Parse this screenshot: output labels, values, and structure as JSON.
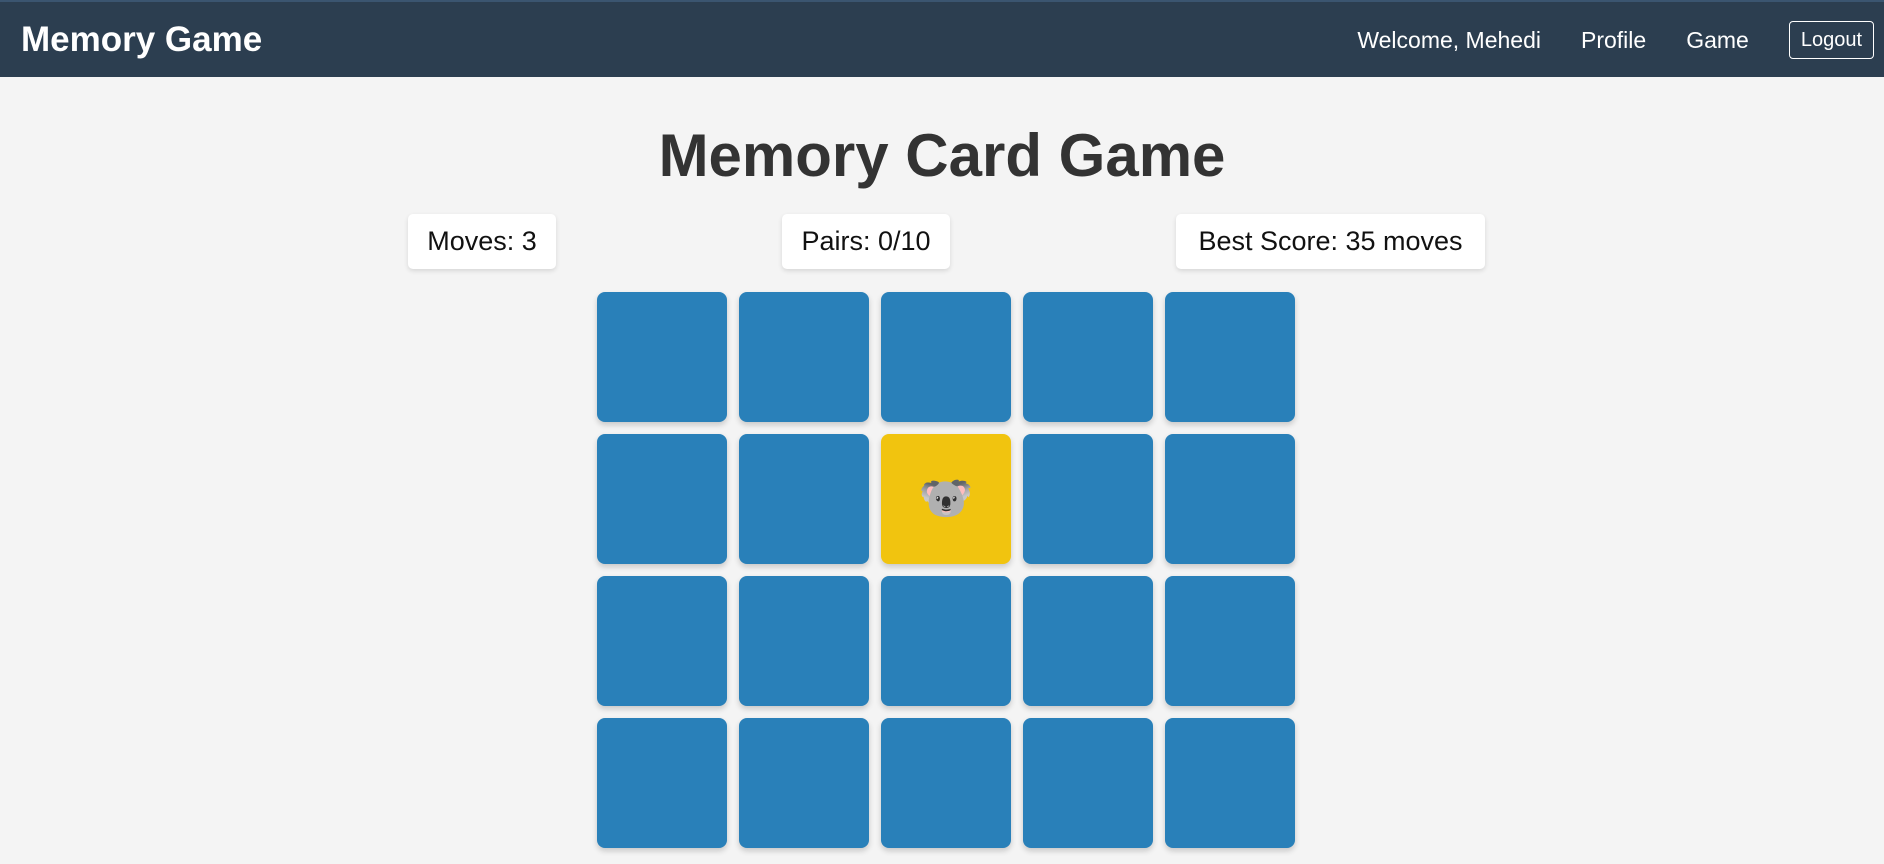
{
  "nav": {
    "brand": "Memory Game",
    "welcome": "Welcome, Mehedi",
    "links": [
      "Profile",
      "Game"
    ],
    "logout": "Logout"
  },
  "title": "Memory Card Game",
  "stats": {
    "moves": "Moves: 3",
    "pairs": "Pairs: 0/10",
    "best": "Best Score: 35 moves"
  },
  "colors": {
    "card_back": "#2980b9",
    "card_flipped": "#f1c40f",
    "navbar": "#2c3e50"
  },
  "board": {
    "columns": 5,
    "cards": [
      {
        "state": "hidden",
        "face": ""
      },
      {
        "state": "hidden",
        "face": ""
      },
      {
        "state": "hidden",
        "face": ""
      },
      {
        "state": "hidden",
        "face": ""
      },
      {
        "state": "hidden",
        "face": ""
      },
      {
        "state": "hidden",
        "face": ""
      },
      {
        "state": "hidden",
        "face": ""
      },
      {
        "state": "flipped",
        "face": "🐨",
        "icon": "koala-icon"
      },
      {
        "state": "hidden",
        "face": ""
      },
      {
        "state": "hidden",
        "face": ""
      },
      {
        "state": "hidden",
        "face": ""
      },
      {
        "state": "hidden",
        "face": ""
      },
      {
        "state": "hidden",
        "face": ""
      },
      {
        "state": "hidden",
        "face": ""
      },
      {
        "state": "hidden",
        "face": ""
      },
      {
        "state": "hidden",
        "face": ""
      },
      {
        "state": "hidden",
        "face": ""
      },
      {
        "state": "hidden",
        "face": ""
      },
      {
        "state": "hidden",
        "face": ""
      },
      {
        "state": "hidden",
        "face": ""
      }
    ]
  }
}
